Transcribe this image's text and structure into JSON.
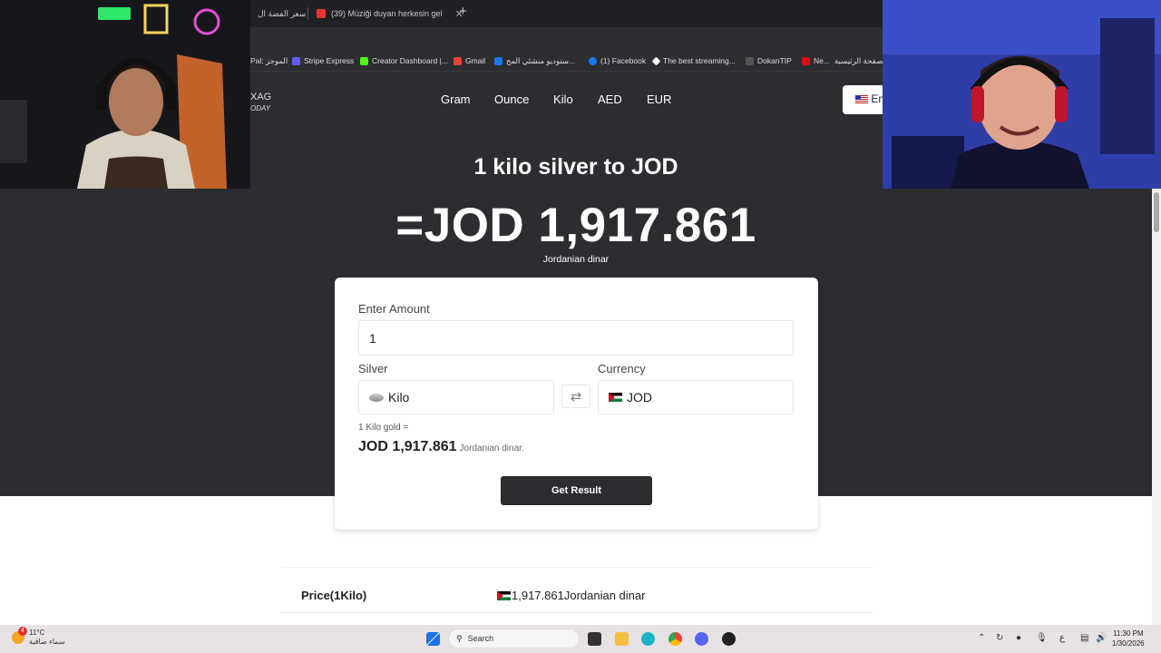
{
  "browser": {
    "tabs": [
      {
        "title": "سعر الفضة ال"
      },
      {
        "title": "(39) Müziği duyan herkesin gel"
      }
    ],
    "new_tab": "+",
    "bookmarks": [
      {
        "label": "Pal: الموجز",
        "color": "#888"
      },
      {
        "label": "Stripe Express",
        "color": "#635bff"
      },
      {
        "label": "Creator Dashboard |...",
        "color": "#53fc18"
      },
      {
        "label": "Gmail",
        "color": "#ea4335"
      },
      {
        "label": "ستوديو منشئي المح...",
        "color": "#1877f2"
      },
      {
        "label": "(1) Facebook",
        "color": "#1877f2"
      },
      {
        "label": "The best streaming...",
        "color": "#ffffff"
      },
      {
        "label": "DokanTIP",
        "color": "#555"
      },
      {
        "label": "Ne...",
        "color": "#e50914"
      },
      {
        "label": "الصفحة الرئيسية -",
        "color": "#888"
      }
    ]
  },
  "site": {
    "logo_top": "XAG",
    "logo_bottom": "ODAY",
    "nav": [
      "Gram",
      "Ounce",
      "Kilo",
      "AED",
      "EUR"
    ],
    "lang_label": "En"
  },
  "hero": {
    "title": "1 kilo silver to JOD",
    "value": "=JOD 1,917.861",
    "unit": "Jordanian dinar"
  },
  "converter": {
    "amount_label": "Enter Amount",
    "amount_value": "1",
    "silver_label": "Silver",
    "silver_value": "Kilo",
    "currency_label": "Currency",
    "currency_value": "JOD",
    "swap_icon": "⇄",
    "note": "1 Kilo gold =",
    "result": "JOD 1,917.861",
    "result_unit": "Jordanian dinar.",
    "button": "Get Result"
  },
  "price_table": {
    "rows": [
      {
        "key": "Price(1Kilo)",
        "value": "1,917.861Jordanian dinar"
      }
    ]
  },
  "taskbar": {
    "temp": "11°C",
    "weather": "سماء صافية",
    "weather_badge": "4",
    "search": "Search",
    "time": "11:30 PM",
    "date": "1/30/2026",
    "ime": "ع"
  }
}
